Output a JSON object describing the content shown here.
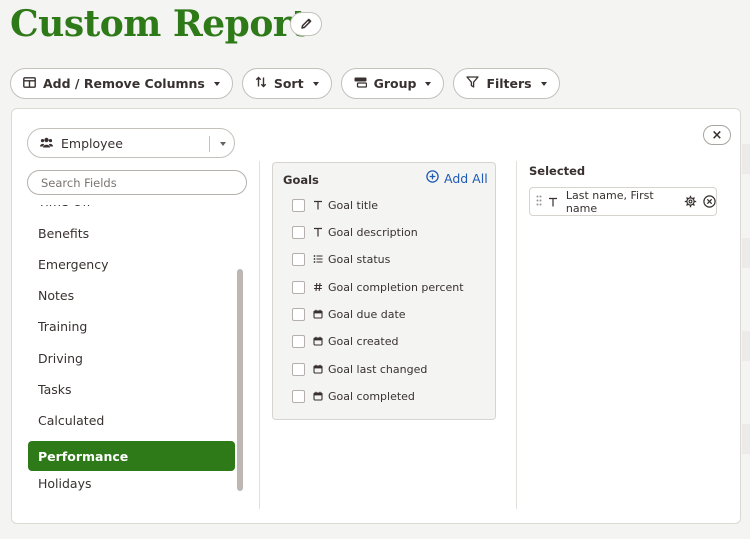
{
  "header": {
    "title": "Custom Report",
    "edit_icon": "pencil-icon"
  },
  "toolbar": {
    "columns_label": "Add / Remove Columns",
    "sort_label": "Sort",
    "group_label": "Group",
    "filters_label": "Filters"
  },
  "panel": {
    "close_label": "×",
    "entity_select": {
      "value": "Employee",
      "icon": "people-icon"
    },
    "search_placeholder": "Search Fields",
    "categories": [
      {
        "label": "Time Off",
        "active": false
      },
      {
        "label": "Benefits",
        "active": false
      },
      {
        "label": "Emergency",
        "active": false
      },
      {
        "label": "Notes",
        "active": false
      },
      {
        "label": "Training",
        "active": false
      },
      {
        "label": "Driving",
        "active": false
      },
      {
        "label": "Tasks",
        "active": false
      },
      {
        "label": "Calculated",
        "active": false
      },
      {
        "label": "Performance",
        "active": true
      },
      {
        "label": "Holidays",
        "active": false
      }
    ],
    "group": {
      "title": "Goals",
      "add_all_label": "Add All",
      "fields": [
        {
          "label": "Goal title",
          "icon": "text-icon"
        },
        {
          "label": "Goal description",
          "icon": "text-icon"
        },
        {
          "label": "Goal status",
          "icon": "list-icon"
        },
        {
          "label": "Goal completion percent",
          "icon": "hash-icon"
        },
        {
          "label": "Goal due date",
          "icon": "calendar-icon"
        },
        {
          "label": "Goal created",
          "icon": "calendar-icon"
        },
        {
          "label": "Goal last changed",
          "icon": "calendar-icon"
        },
        {
          "label": "Goal completed",
          "icon": "calendar-icon"
        }
      ]
    },
    "selected": {
      "title": "Selected",
      "items": [
        {
          "label": "Last name, First name",
          "icon": "text-icon"
        }
      ]
    }
  },
  "colors": {
    "brand_green": "#2e7918",
    "link_blue": "#1f5ab4",
    "text": "#38312f"
  }
}
